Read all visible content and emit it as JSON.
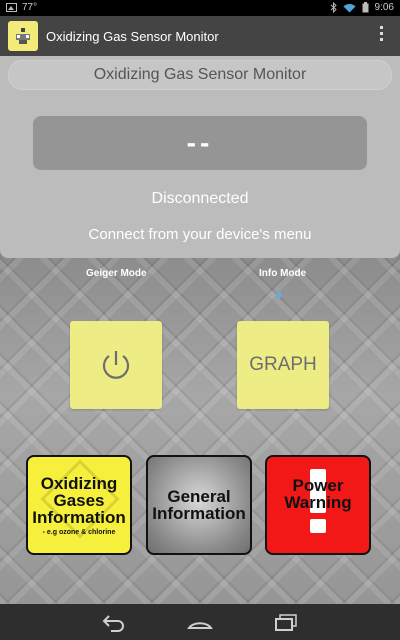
{
  "status_bar": {
    "temperature": "77°",
    "time": "9:06"
  },
  "action_bar": {
    "title": "Oxidizing Gas Sensor Monitor"
  },
  "panel": {
    "header": "Oxidizing Gas Sensor Monitor",
    "readout": "--",
    "status": "Disconnected",
    "hint": "Connect from your device's menu"
  },
  "modes": {
    "geiger": "Geiger Mode",
    "info": "Info Mode"
  },
  "buttons": {
    "graph": "GRAPH",
    "oxidizing_line1": "Oxidizing",
    "oxidizing_line2": "Gases",
    "oxidizing_line3": "Information",
    "oxidizing_sub": "- e.g ozone & chlorine",
    "general_line1": "General",
    "general_line2": "Information",
    "power_line1": "Power",
    "power_line2": "Warning"
  },
  "colors": {
    "button_yellow": "#eeec84",
    "oxidizing_yellow": "#f6ef3c",
    "warning_red": "#f21818",
    "action_bar": "#444444"
  }
}
